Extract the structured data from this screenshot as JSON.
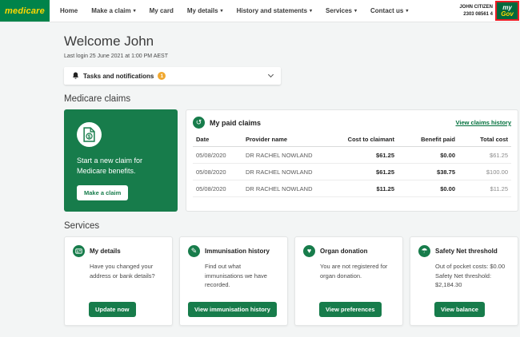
{
  "colors": {
    "brand_green": "#00834A",
    "logo_yellow": "#FFD800",
    "action_green": "#177C4B",
    "link_green": "#00703C",
    "badge_amber": "#F0A830",
    "highlight_red": "#ED1C24",
    "mygov_green": "#00693C"
  },
  "nav": {
    "brand": "medicare",
    "items": [
      {
        "label": "Home",
        "dropdown": false
      },
      {
        "label": "Make a claim",
        "dropdown": true
      },
      {
        "label": "My card",
        "dropdown": false
      },
      {
        "label": "My details",
        "dropdown": true
      },
      {
        "label": "History and statements",
        "dropdown": true
      },
      {
        "label": "Services",
        "dropdown": true
      },
      {
        "label": "Contact us",
        "dropdown": true
      }
    ],
    "user_name": "JOHN CITIZEN",
    "user_number": "2303 08561 4",
    "mygov_line1": "my",
    "mygov_line2": "Gov"
  },
  "header": {
    "welcome": "Welcome John",
    "last_login": "Last login 25 June 2021 at 1:00 PM AEST"
  },
  "tasks": {
    "label": "Tasks and notifications",
    "badge_count": "1"
  },
  "claims": {
    "heading": "Medicare claims",
    "start_claim_text": "Start a new claim for Medicare benefits.",
    "make_claim_button": "Make a claim",
    "paid_claims_title": "My paid claims",
    "view_history_link": "View claims history",
    "columns": [
      "Date",
      "Provider name",
      "Cost to claimant",
      "Benefit paid",
      "Total cost"
    ],
    "rows": [
      {
        "date": "05/08/2020",
        "provider": "DR RACHEL NOWLAND",
        "cost": "$61.25",
        "benefit": "$0.00",
        "total": "$61.25"
      },
      {
        "date": "05/08/2020",
        "provider": "DR RACHEL NOWLAND",
        "cost": "$61.25",
        "benefit": "$38.75",
        "total": "$100.00"
      },
      {
        "date": "05/08/2020",
        "provider": "DR RACHEL NOWLAND",
        "cost": "$11.25",
        "benefit": "$0.00",
        "total": "$11.25"
      }
    ]
  },
  "services": {
    "heading": "Services",
    "cards": [
      {
        "title": "My details",
        "icon": "id-card-icon",
        "body": "Have you changed your address or bank details?",
        "body2": "",
        "button": "Update now"
      },
      {
        "title": "Immunisation history",
        "icon": "syringe-icon",
        "body": "Find out what immunisations we have recorded.",
        "body2": "",
        "button": "View immunisation history"
      },
      {
        "title": "Organ donation",
        "icon": "heart-icon",
        "body": "You are not registered for organ donation.",
        "body2": "",
        "button": "View preferences"
      },
      {
        "title": "Safety Net threshold",
        "icon": "umbrella-icon",
        "body": "Out of pocket costs: $0.00",
        "body2": "Safety Net threshold: $2,184.30",
        "button": "View balance"
      }
    ]
  }
}
